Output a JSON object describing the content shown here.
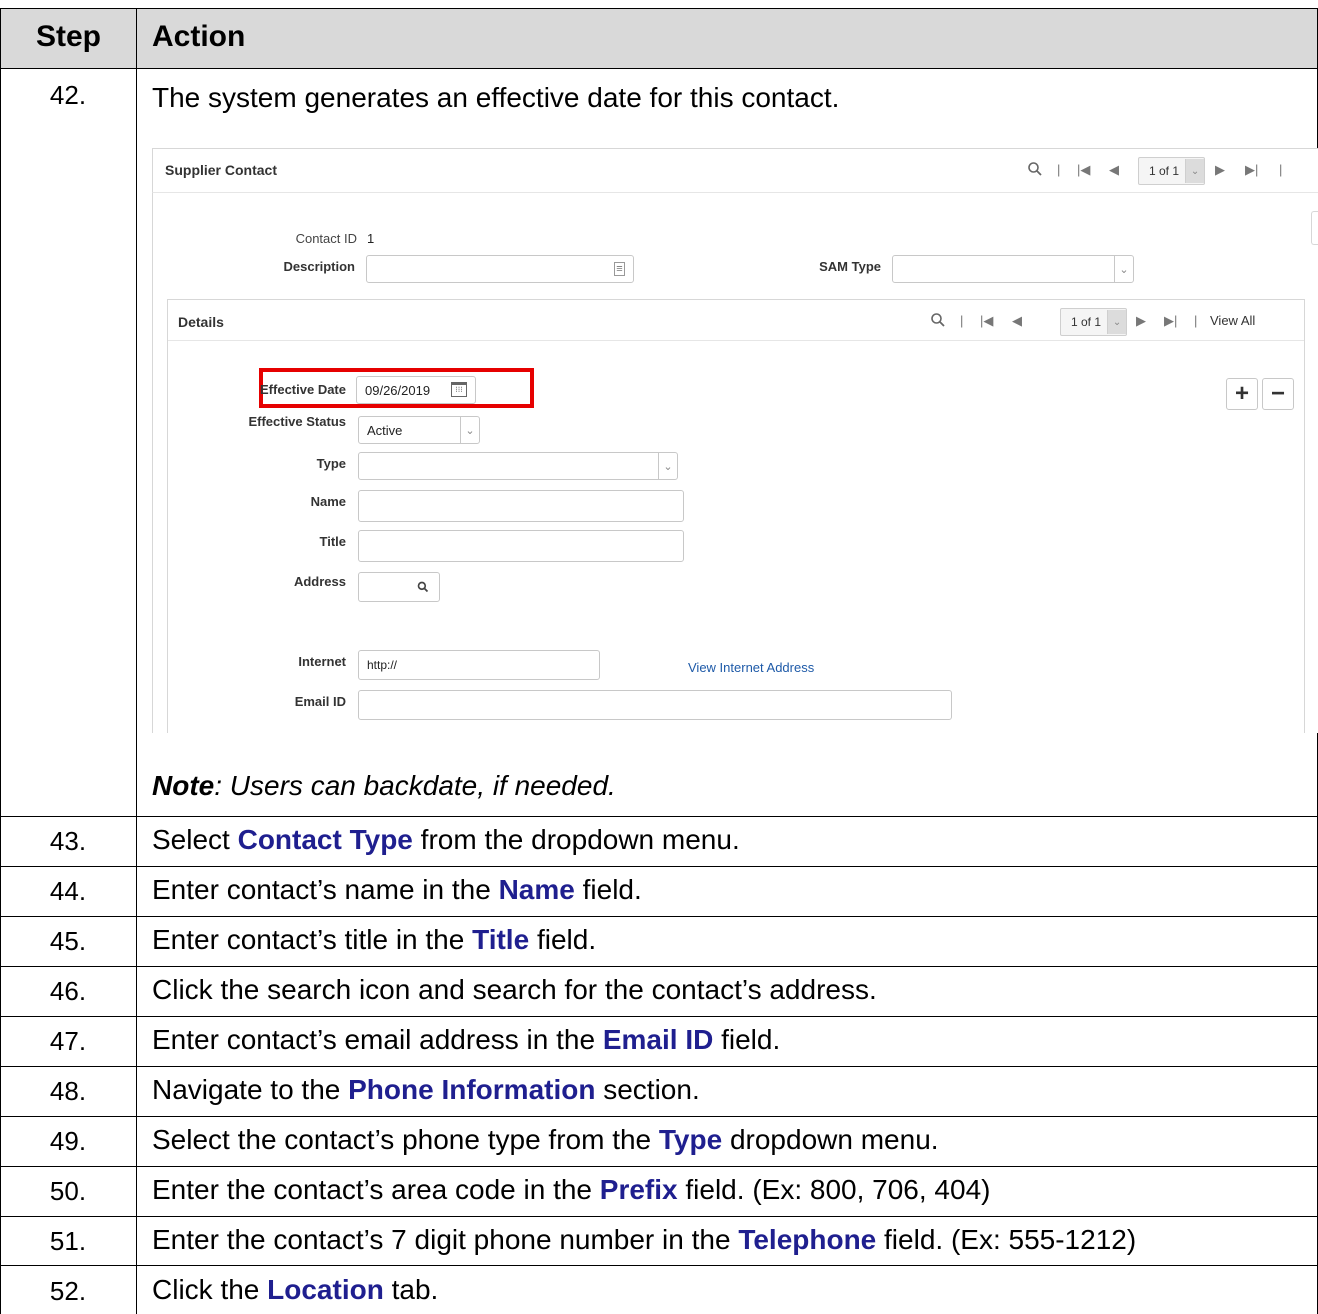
{
  "header": {
    "step": "Step",
    "action": "Action"
  },
  "rows": [
    {
      "step": "42.",
      "text": "The system generates an effective date for this contact."
    },
    {
      "step": "43.",
      "pre": "Select ",
      "kw": "Contact Type",
      "post": " from the dropdown menu."
    },
    {
      "step": "44.",
      "pre": "Enter contact’s name in the ",
      "kw": "Name",
      "post": " field."
    },
    {
      "step": "45.",
      "pre": "Enter contact’s title in the ",
      "kw": "Title",
      "post": " field."
    },
    {
      "step": "46.",
      "pre": "Click the search icon and search for the contact’s address.",
      "kw": "",
      "post": ""
    },
    {
      "step": "47.",
      "pre": "Enter contact’s email address in the ",
      "kw": "Email ID",
      "post": " field."
    },
    {
      "step": "48.",
      "pre": "Navigate to the ",
      "kw": "Phone Information",
      "post": " section."
    },
    {
      "step": "49.",
      "pre": "Select the contact’s phone type from the ",
      "kw": "Type",
      "post": " dropdown menu."
    },
    {
      "step": "50.",
      "pre": "Enter the contact’s area code in the ",
      "kw": "Prefix",
      "post": " field. (Ex: 800, 706, 404)"
    },
    {
      "step": "51.",
      "pre": "Enter the contact’s 7 digit phone number in the ",
      "kw": "Telephone",
      "post": " field. (Ex: 555-1212)"
    },
    {
      "step": "52.",
      "pre": "Click the ",
      "kw": "Location",
      "post": " tab."
    }
  ],
  "note": {
    "label": "Note",
    "text": ": Users can backdate, if needed."
  },
  "screenshot": {
    "title": "Supplier Contact",
    "pager": "1 of 1",
    "contact_id_label": "Contact ID",
    "contact_id_value": "1",
    "description_label": "Description",
    "sam_type_label": "SAM Type",
    "details_title": "Details",
    "details_pager": "1 of 1",
    "view_all": "View All",
    "effective_date_label": "Effective Date",
    "effective_date_value": "09/26/2019",
    "effective_status_label": "Effective Status",
    "effective_status_value": "Active",
    "type_label": "Type",
    "name_label": "Name",
    "title_label": "Title",
    "address_label": "Address",
    "internet_label": "Internet",
    "internet_value": "http://",
    "view_internet_address": "View Internet Address",
    "email_id_label": "Email ID"
  }
}
